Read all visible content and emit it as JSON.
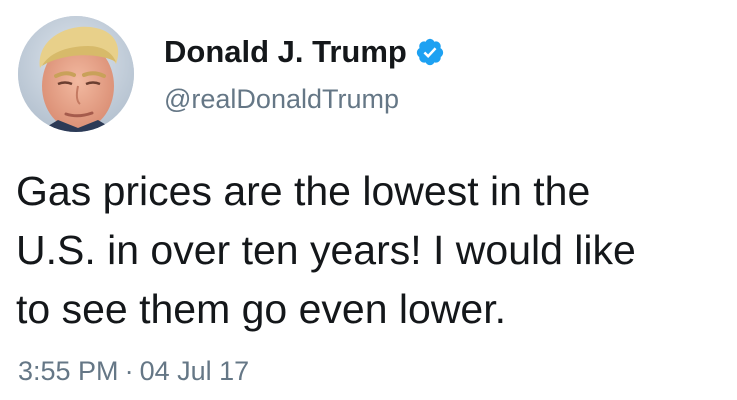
{
  "author": {
    "display_name": "Donald J. Trump",
    "handle": "@realDonaldTrump",
    "verified": true,
    "verified_icon": "verified-badge-icon",
    "avatar_icon": "profile-photo"
  },
  "tweet": {
    "lines": [
      "Gas prices are the lowest in the",
      "U.S. in over ten years! I would like",
      "to see them go even lower."
    ],
    "time": "3:55 PM",
    "separator": "·",
    "date": "04 Jul 17"
  },
  "colors": {
    "text": "#14171a",
    "secondary": "#657786",
    "verified": "#1da1f2",
    "background": "#ffffff"
  }
}
